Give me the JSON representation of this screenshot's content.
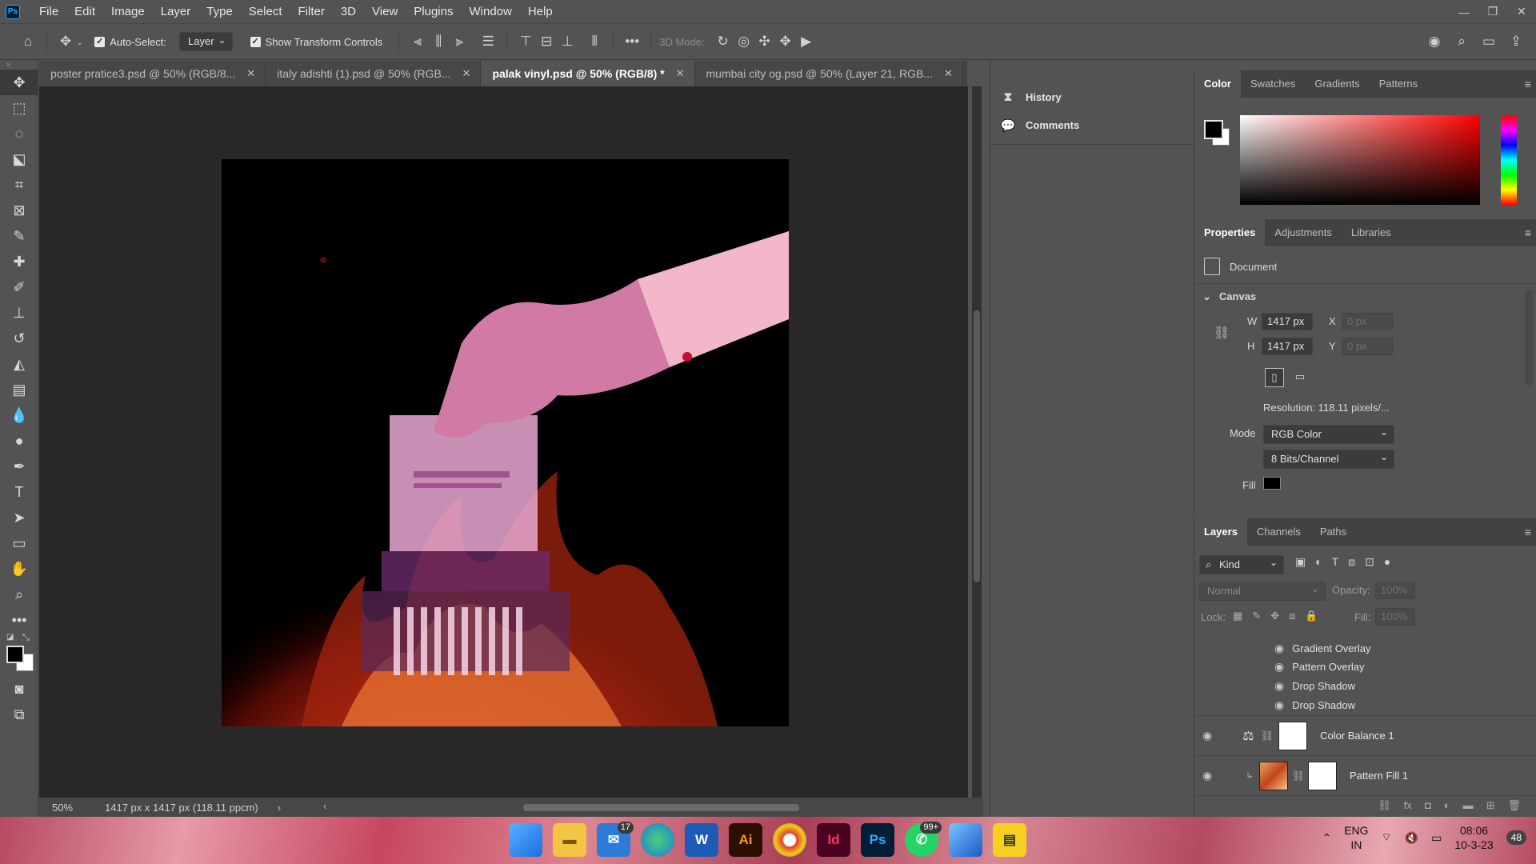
{
  "menubar": {
    "logo": "Ps",
    "items": [
      "File",
      "Edit",
      "Image",
      "Layer",
      "Type",
      "Select",
      "Filter",
      "3D",
      "View",
      "Plugins",
      "Window",
      "Help"
    ]
  },
  "options": {
    "auto_select_label": "Auto-Select:",
    "auto_select_value": "Layer",
    "show_transform_label": "Show Transform Controls",
    "mode_3d_label": "3D Mode:"
  },
  "tabs": [
    {
      "label": "poster pratice3.psd @ 50% (RGB/8..."
    },
    {
      "label": "italy adishti (1).psd @ 50% (RGB..."
    },
    {
      "label": "palak vinyl.psd @ 50% (RGB/8) *"
    },
    {
      "label": "mumbai city og.psd @ 50% (Layer 21, RGB..."
    }
  ],
  "status": {
    "zoom": "50%",
    "doc_info": "1417 px x 1417 px (118.11 ppcm)"
  },
  "midpanel": {
    "history": "History",
    "comments": "Comments"
  },
  "color_panel": {
    "tabs": [
      "Color",
      "Swatches",
      "Gradients",
      "Patterns"
    ],
    "foreground": "#000000",
    "background": "#ffffff"
  },
  "properties": {
    "tabs": [
      "Properties",
      "Adjustments",
      "Libraries"
    ],
    "doc_label": "Document",
    "section": "Canvas",
    "w_label": "W",
    "w_value": "1417 px",
    "h_label": "H",
    "h_value": "1417 px",
    "x_label": "X",
    "x_value": "0 px",
    "y_label": "Y",
    "y_value": "0 px",
    "resolution": "Resolution: 118.11 pixels/...",
    "mode_label": "Mode",
    "mode_value": "RGB Color",
    "bits_value": "8 Bits/Channel",
    "fill_label": "Fill",
    "fill_color": "#000000"
  },
  "layers": {
    "tabs": [
      "Layers",
      "Channels",
      "Paths"
    ],
    "kind_label": "Kind",
    "blend_mode": "Normal",
    "opacity_label": "Opacity:",
    "opacity_value": "100%",
    "lock_label": "Lock:",
    "fill_label": "Fill:",
    "fill_value": "100%",
    "effects": [
      "Gradient Overlay",
      "Pattern Overlay",
      "Drop Shadow",
      "Drop Shadow"
    ],
    "rows": [
      {
        "name": "Color Balance 1"
      },
      {
        "name": "Pattern Fill 1"
      }
    ]
  },
  "taskbar": {
    "mail_badge": "17",
    "whatsapp_badge": "99+",
    "word_label": "W",
    "ai_label": "Ai",
    "id_label": "Id",
    "ps_label": "Ps",
    "lang_top": "ENG",
    "lang_bottom": "IN",
    "time": "08:06",
    "date": "10-3-23",
    "notif_count": "48"
  }
}
